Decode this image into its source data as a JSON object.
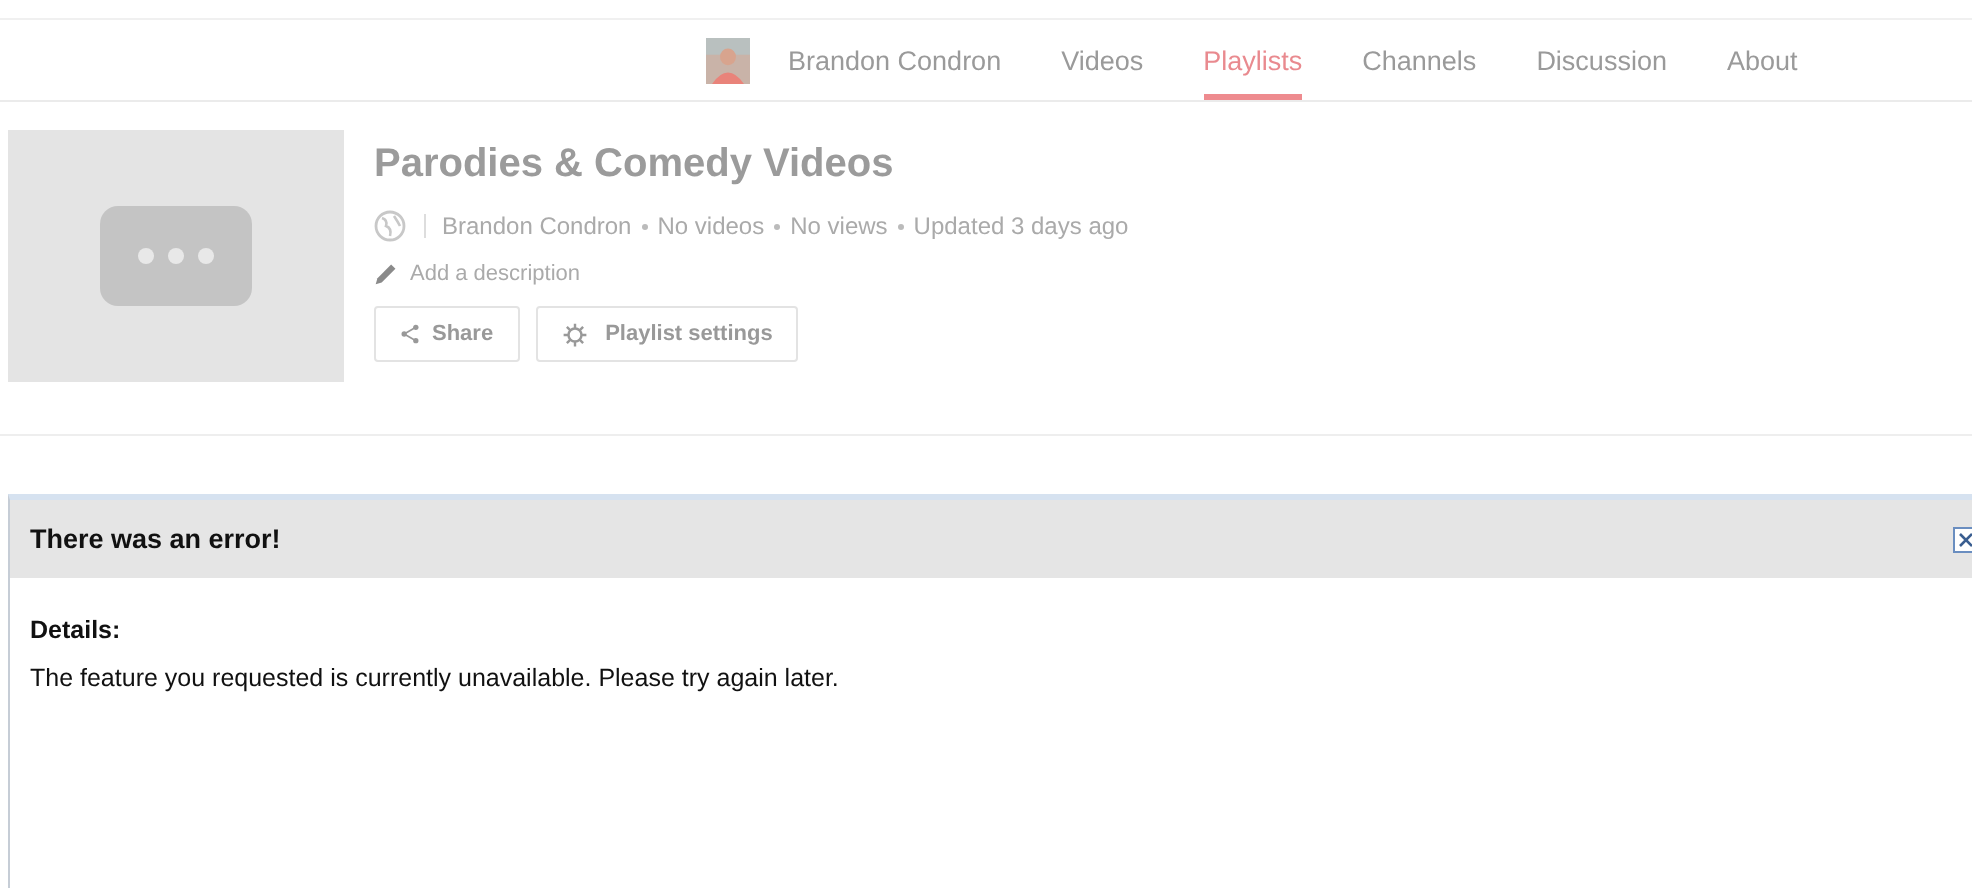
{
  "nav": {
    "tabs": [
      {
        "label": "Brandon Condron",
        "selected": false
      },
      {
        "label": "Videos",
        "selected": false
      },
      {
        "label": "Playlists",
        "selected": true
      },
      {
        "label": "Channels",
        "selected": false
      },
      {
        "label": "Discussion",
        "selected": false
      },
      {
        "label": "About",
        "selected": false
      }
    ]
  },
  "playlist": {
    "title": "Parodies & Comedy Videos",
    "meta": [
      "Brandon Condron",
      "No videos",
      "No views",
      "Updated 3 days ago"
    ],
    "description_placeholder": "Add a description",
    "buttons": [
      {
        "kind": "share",
        "label": "Share"
      },
      {
        "kind": "settings",
        "label": "Playlist settings"
      }
    ]
  },
  "dialog": {
    "title": "There was an error!",
    "details_label": "Details:",
    "message": "The feature you requested is currently unavailable. Please try again later."
  }
}
